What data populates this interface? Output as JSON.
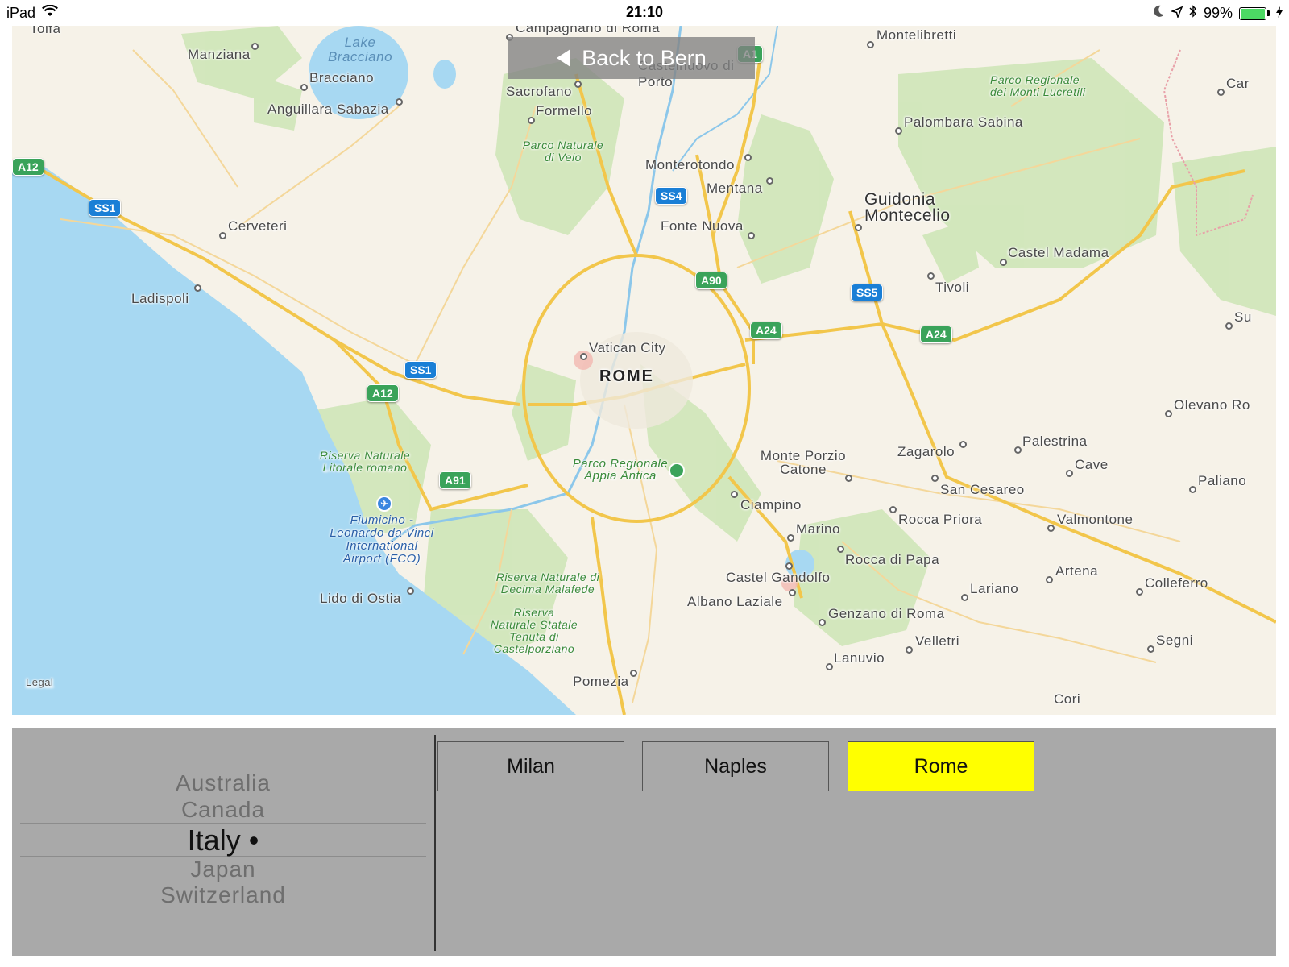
{
  "status_bar": {
    "device": "iPad",
    "time": "21:10",
    "battery": "99%",
    "battery_level": 0.99,
    "icons": [
      "wifi-icon",
      "moon-icon",
      "location-arrow-icon",
      "bluetooth-icon",
      "battery-icon",
      "charging-icon"
    ]
  },
  "map": {
    "back_button": "Back to Bern",
    "legal": "Legal",
    "capital": "ROME",
    "places": {
      "tolfa": "Tolfa",
      "campagnano": "Campagnano di Roma",
      "montelibretti": "Montelibretti",
      "manziana": "Manziana",
      "bracciano": "Bracciano",
      "anguillara": "Anguillara Sabazia",
      "sacrofano": "Sacrofano",
      "castelnuovo": "Castelnuovo di Porto",
      "formello": "Formello",
      "palombara": "Palombara Sabina",
      "car": "Car",
      "monterotondo": "Monterotondo",
      "mentana": "Mentana",
      "guidonia": "Guidonia Montecelio",
      "fonte_nuova": "Fonte Nuova",
      "cerveteri": "Cerveteri",
      "castel_madama": "Castel Madama",
      "tivoli": "Tivoli",
      "ladispoli": "Ladispoli",
      "su": "Su",
      "vatican": "Vatican City",
      "olevano": "Olevano Ro",
      "palestrina": "Palestrina",
      "zagarolo": "Zagarolo",
      "monte_porzio": "Monte Porzio Catone",
      "cave": "Cave",
      "paliano": "Paliano",
      "san_cesareo": "San Cesareo",
      "ciampino": "Ciampino",
      "rocca_priora": "Rocca Priora",
      "valmontone": "Valmontone",
      "marino": "Marino",
      "rocca_di_papa": "Rocca di Papa",
      "artena": "Artena",
      "castel_gandolfo": "Castel Gandolfo",
      "lariano": "Lariano",
      "colleferro": "Colleferro",
      "albano": "Albano Laziale",
      "genzano": "Genzano di Roma",
      "lido": "Lido di Ostia",
      "velletri": "Velletri",
      "segni": "Segni",
      "lanuvio": "Lanuvio",
      "pomezia": "Pomezia",
      "cori": "Cori"
    },
    "parks": {
      "veio": "Parco Naturale di Veio",
      "lucretili": "Parco Regionale dei Monti Lucretili",
      "litorale": "Riserva Naturale Litorale romano",
      "appia": "Parco Regionale Appia Antica",
      "decima": "Riserva Naturale di Decima Malafede",
      "castelporziano": "Riserva Naturale Statale Tenuta di Castelporziano"
    },
    "water": {
      "lake": "Lake Bracciano"
    },
    "airport": "Fiumicino - Leonardo da Vinci International Airport (FCO)",
    "shields": {
      "a1": "A1",
      "a12_1": "A12",
      "a12_2": "A12",
      "ss1_1": "SS1",
      "ss1_2": "SS1",
      "ss4": "SS4",
      "a90": "A90",
      "a24_1": "A24",
      "a24_2": "A24",
      "ss5": "SS5",
      "a91": "A91"
    }
  },
  "picker": {
    "items": [
      "Australia",
      "Canada",
      "Italy •",
      "Japan",
      "Switzerland"
    ],
    "selected_index": 2
  },
  "cities": {
    "buttons": [
      "Milan",
      "Naples",
      "Rome"
    ],
    "active_index": 2,
    "active_color": "#ffff00"
  }
}
